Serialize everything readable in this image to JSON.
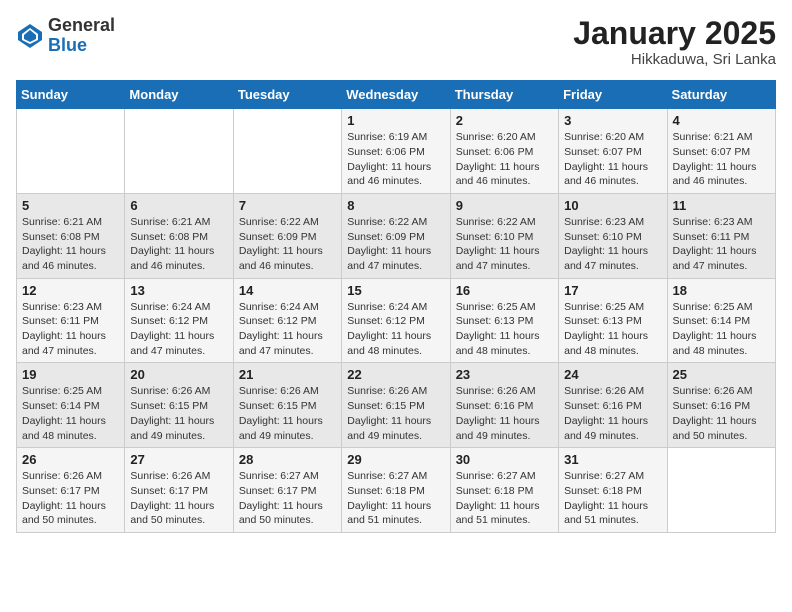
{
  "header": {
    "logo_general": "General",
    "logo_blue": "Blue",
    "month_title": "January 2025",
    "location": "Hikkaduwa, Sri Lanka"
  },
  "days_of_week": [
    "Sunday",
    "Monday",
    "Tuesday",
    "Wednesday",
    "Thursday",
    "Friday",
    "Saturday"
  ],
  "weeks": [
    [
      {
        "day": "",
        "info": ""
      },
      {
        "day": "",
        "info": ""
      },
      {
        "day": "",
        "info": ""
      },
      {
        "day": "1",
        "info": "Sunrise: 6:19 AM\nSunset: 6:06 PM\nDaylight: 11 hours\nand 46 minutes."
      },
      {
        "day": "2",
        "info": "Sunrise: 6:20 AM\nSunset: 6:06 PM\nDaylight: 11 hours\nand 46 minutes."
      },
      {
        "day": "3",
        "info": "Sunrise: 6:20 AM\nSunset: 6:07 PM\nDaylight: 11 hours\nand 46 minutes."
      },
      {
        "day": "4",
        "info": "Sunrise: 6:21 AM\nSunset: 6:07 PM\nDaylight: 11 hours\nand 46 minutes."
      }
    ],
    [
      {
        "day": "5",
        "info": "Sunrise: 6:21 AM\nSunset: 6:08 PM\nDaylight: 11 hours\nand 46 minutes."
      },
      {
        "day": "6",
        "info": "Sunrise: 6:21 AM\nSunset: 6:08 PM\nDaylight: 11 hours\nand 46 minutes."
      },
      {
        "day": "7",
        "info": "Sunrise: 6:22 AM\nSunset: 6:09 PM\nDaylight: 11 hours\nand 46 minutes."
      },
      {
        "day": "8",
        "info": "Sunrise: 6:22 AM\nSunset: 6:09 PM\nDaylight: 11 hours\nand 47 minutes."
      },
      {
        "day": "9",
        "info": "Sunrise: 6:22 AM\nSunset: 6:10 PM\nDaylight: 11 hours\nand 47 minutes."
      },
      {
        "day": "10",
        "info": "Sunrise: 6:23 AM\nSunset: 6:10 PM\nDaylight: 11 hours\nand 47 minutes."
      },
      {
        "day": "11",
        "info": "Sunrise: 6:23 AM\nSunset: 6:11 PM\nDaylight: 11 hours\nand 47 minutes."
      }
    ],
    [
      {
        "day": "12",
        "info": "Sunrise: 6:23 AM\nSunset: 6:11 PM\nDaylight: 11 hours\nand 47 minutes."
      },
      {
        "day": "13",
        "info": "Sunrise: 6:24 AM\nSunset: 6:12 PM\nDaylight: 11 hours\nand 47 minutes."
      },
      {
        "day": "14",
        "info": "Sunrise: 6:24 AM\nSunset: 6:12 PM\nDaylight: 11 hours\nand 47 minutes."
      },
      {
        "day": "15",
        "info": "Sunrise: 6:24 AM\nSunset: 6:12 PM\nDaylight: 11 hours\nand 48 minutes."
      },
      {
        "day": "16",
        "info": "Sunrise: 6:25 AM\nSunset: 6:13 PM\nDaylight: 11 hours\nand 48 minutes."
      },
      {
        "day": "17",
        "info": "Sunrise: 6:25 AM\nSunset: 6:13 PM\nDaylight: 11 hours\nand 48 minutes."
      },
      {
        "day": "18",
        "info": "Sunrise: 6:25 AM\nSunset: 6:14 PM\nDaylight: 11 hours\nand 48 minutes."
      }
    ],
    [
      {
        "day": "19",
        "info": "Sunrise: 6:25 AM\nSunset: 6:14 PM\nDaylight: 11 hours\nand 48 minutes."
      },
      {
        "day": "20",
        "info": "Sunrise: 6:26 AM\nSunset: 6:15 PM\nDaylight: 11 hours\nand 49 minutes."
      },
      {
        "day": "21",
        "info": "Sunrise: 6:26 AM\nSunset: 6:15 PM\nDaylight: 11 hours\nand 49 minutes."
      },
      {
        "day": "22",
        "info": "Sunrise: 6:26 AM\nSunset: 6:15 PM\nDaylight: 11 hours\nand 49 minutes."
      },
      {
        "day": "23",
        "info": "Sunrise: 6:26 AM\nSunset: 6:16 PM\nDaylight: 11 hours\nand 49 minutes."
      },
      {
        "day": "24",
        "info": "Sunrise: 6:26 AM\nSunset: 6:16 PM\nDaylight: 11 hours\nand 49 minutes."
      },
      {
        "day": "25",
        "info": "Sunrise: 6:26 AM\nSunset: 6:16 PM\nDaylight: 11 hours\nand 50 minutes."
      }
    ],
    [
      {
        "day": "26",
        "info": "Sunrise: 6:26 AM\nSunset: 6:17 PM\nDaylight: 11 hours\nand 50 minutes."
      },
      {
        "day": "27",
        "info": "Sunrise: 6:26 AM\nSunset: 6:17 PM\nDaylight: 11 hours\nand 50 minutes."
      },
      {
        "day": "28",
        "info": "Sunrise: 6:27 AM\nSunset: 6:17 PM\nDaylight: 11 hours\nand 50 minutes."
      },
      {
        "day": "29",
        "info": "Sunrise: 6:27 AM\nSunset: 6:18 PM\nDaylight: 11 hours\nand 51 minutes."
      },
      {
        "day": "30",
        "info": "Sunrise: 6:27 AM\nSunset: 6:18 PM\nDaylight: 11 hours\nand 51 minutes."
      },
      {
        "day": "31",
        "info": "Sunrise: 6:27 AM\nSunset: 6:18 PM\nDaylight: 11 hours\nand 51 minutes."
      },
      {
        "day": "",
        "info": ""
      }
    ]
  ]
}
